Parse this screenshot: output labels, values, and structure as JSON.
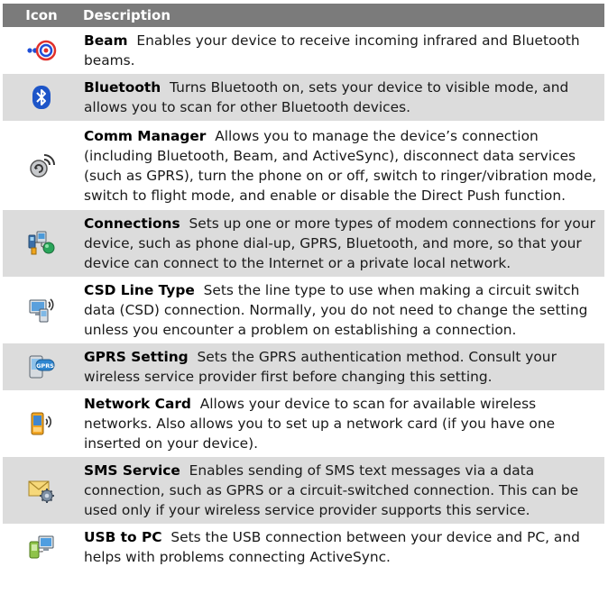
{
  "header": {
    "icon": "Icon",
    "description": "Description"
  },
  "rows": [
    {
      "icon": "beam-icon",
      "title": "Beam",
      "text": "Enables your device to receive incoming infrared and Bluetooth beams."
    },
    {
      "icon": "bluetooth-icon",
      "title": "Bluetooth",
      "text": "Turns Bluetooth on, sets your device to visible mode, and allows you to scan for other Bluetooth devices."
    },
    {
      "icon": "comm-manager-icon",
      "title": "Comm Manager",
      "text": "Allows you to manage the device’s connection (including Bluetooth, Beam, and ActiveSync), disconnect data services (such as GPRS), turn the phone on or off, switch to ringer/vibration mode, switch to flight mode, and enable or disable the Direct Push function."
    },
    {
      "icon": "connections-icon",
      "title": "Connections",
      "text": "Sets up one or more types of modem connections for your device, such as phone dial-up, GPRS, Bluetooth, and more, so that your device can connect to the Internet or a private local network."
    },
    {
      "icon": "csd-line-type-icon",
      "title": "CSD Line Type",
      "text": "Sets the line type to use when making a circuit switch data (CSD) connection. Normally, you do not need to change the setting unless you encounter a problem on establishing a connection."
    },
    {
      "icon": "gprs-setting-icon",
      "title": "GPRS Setting",
      "text": "Sets the GPRS authentication method. Consult your wireless service provider first before changing this setting."
    },
    {
      "icon": "network-card-icon",
      "title": "Network Card",
      "text": "Allows your device to scan for available wireless networks. Also allows you to set up a network card (if you have one inserted on your device)."
    },
    {
      "icon": "sms-service-icon",
      "title": "SMS Service",
      "text": "Enables sending of SMS text messages via a data connection, such as GPRS or a circuit-switched connection. This can be used only if your wireless service provider supports this service."
    },
    {
      "icon": "usb-to-pc-icon",
      "title": "USB to PC",
      "text": "Sets the USB connection between your device and PC, and helps with problems connecting ActiveSync."
    }
  ],
  "icon_labels": {
    "gprs": "GPRS"
  }
}
